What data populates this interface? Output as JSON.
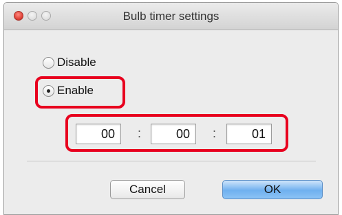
{
  "window": {
    "title": "Bulb timer settings"
  },
  "mode": {
    "selected": "enable",
    "options": [
      {
        "id": "disable",
        "label": "Disable"
      },
      {
        "id": "enable",
        "label": "Enable"
      }
    ]
  },
  "timer": {
    "hours": "00",
    "minutes": "00",
    "seconds": "01",
    "separator": ":"
  },
  "buttons": {
    "cancel": "Cancel",
    "ok": "OK"
  },
  "colors": {
    "highlight": "#e8001e",
    "default_button": "#6fb0ef"
  }
}
